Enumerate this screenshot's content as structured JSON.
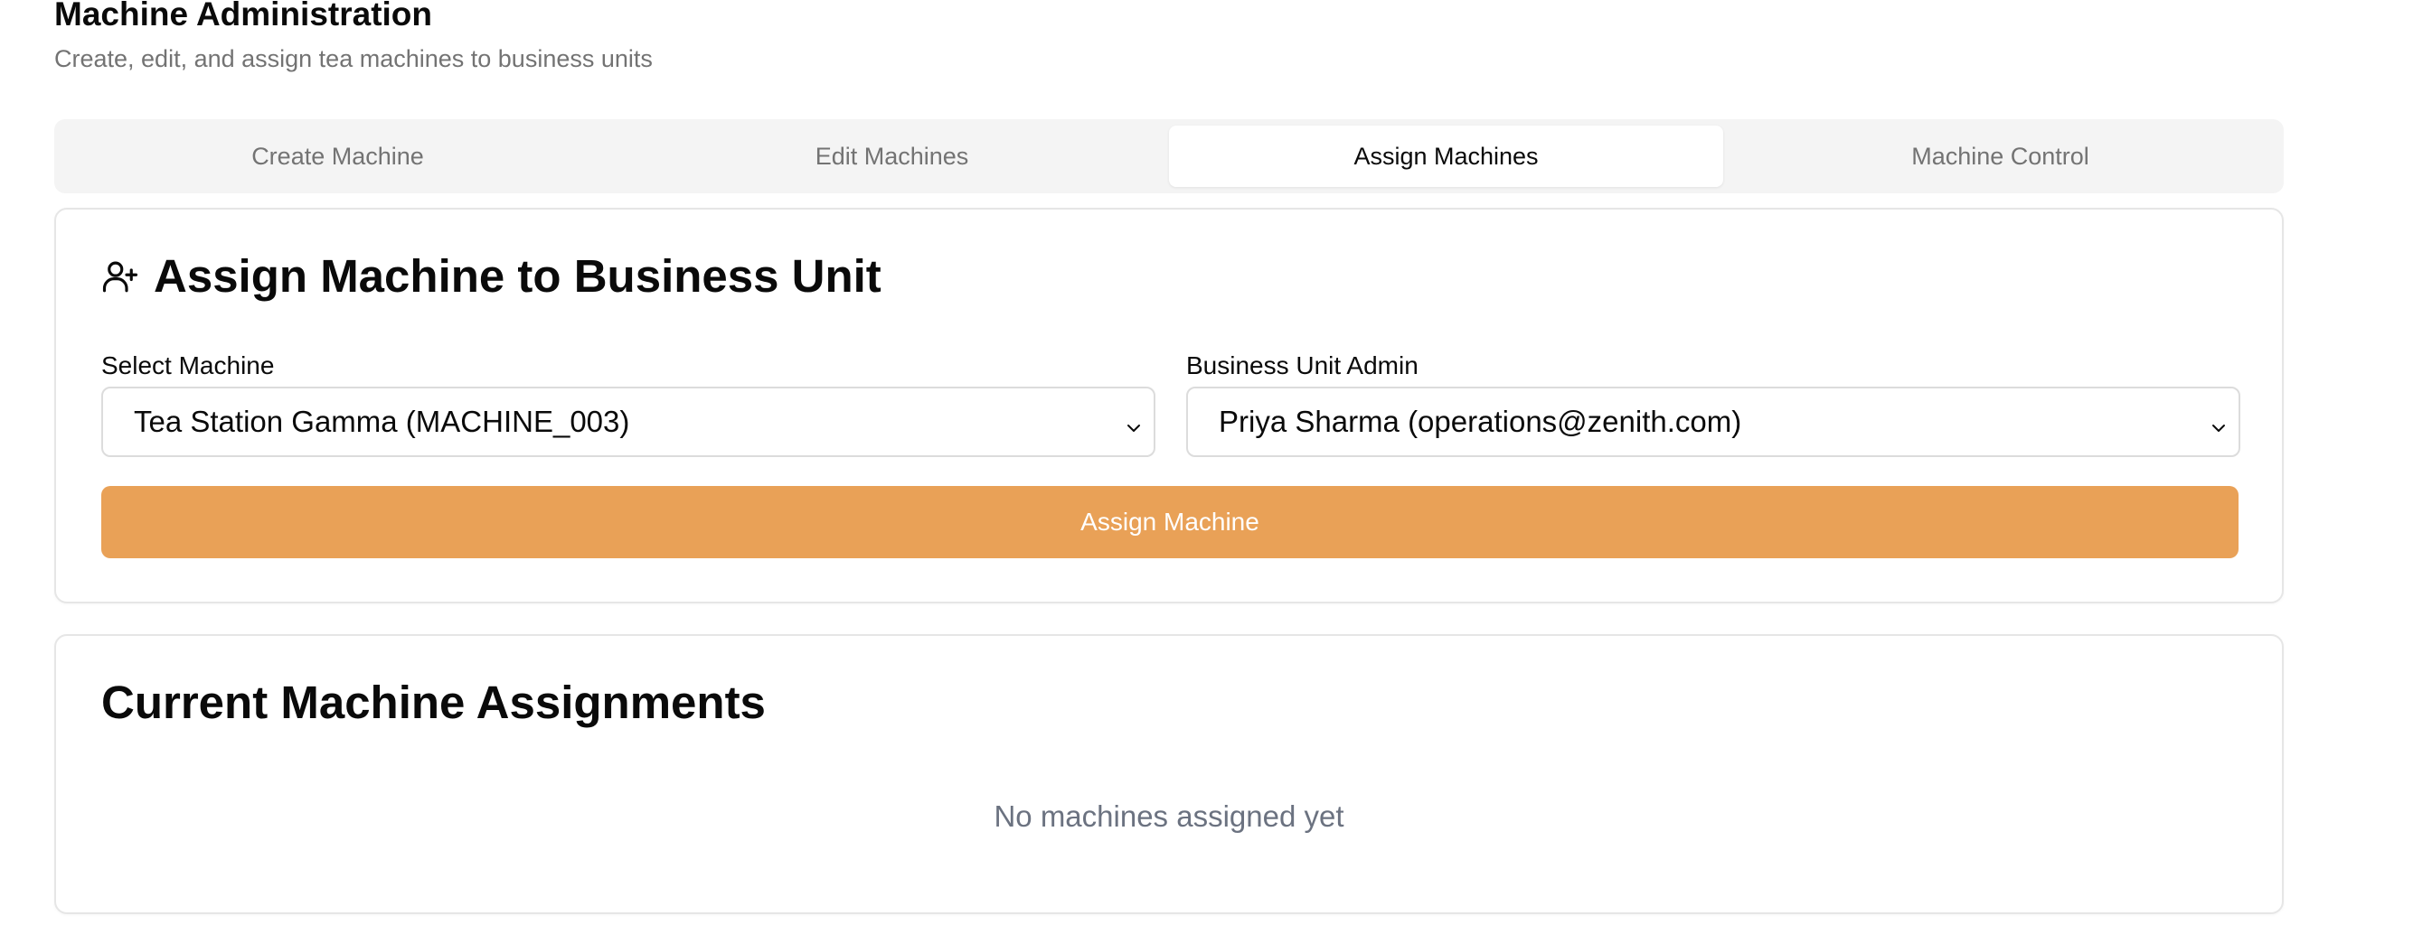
{
  "header": {
    "title": "Machine Administration",
    "subtitle": "Create, edit, and assign tea machines to business units"
  },
  "tabs": [
    {
      "label": "Create Machine",
      "active": false
    },
    {
      "label": "Edit Machines",
      "active": false
    },
    {
      "label": "Assign Machines",
      "active": true
    },
    {
      "label": "Machine Control",
      "active": false
    }
  ],
  "assign_card": {
    "icon": "user-plus-icon",
    "title": "Assign Machine to Business Unit",
    "machine_field": {
      "label": "Select Machine",
      "value": "Tea Station Gamma (MACHINE_003)"
    },
    "admin_field": {
      "label": "Business Unit Admin",
      "value": "Priya Sharma (operations@zenith.com)"
    },
    "button_label": "Assign Machine"
  },
  "current_card": {
    "title": "Current Machine Assignments",
    "empty_text": "No machines assigned yet"
  },
  "colors": {
    "accent": "#e9a157",
    "muted_text": "#737373",
    "tab_bg": "#f4f4f4",
    "border": "#e6e6e6"
  }
}
